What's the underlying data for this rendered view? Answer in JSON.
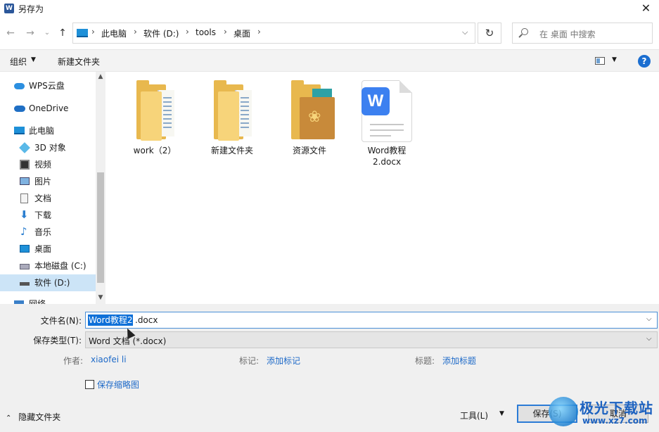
{
  "window": {
    "title": "另存为",
    "app_icon_letter": "W"
  },
  "nav": {
    "back_glyph": "←",
    "forward_glyph": "→",
    "recent_glyph": "⌄",
    "up_glyph": "↑",
    "breadcrumbs": [
      "此电脑",
      "软件 (D:)",
      "tools",
      "桌面"
    ],
    "separator": "›",
    "refresh_glyph": "↻",
    "search_placeholder": "在 桌面 中搜索"
  },
  "toolbar": {
    "organize_label": "组织",
    "new_folder_label": "新建文件夹"
  },
  "sidebar": {
    "items": [
      {
        "label": "WPS云盘",
        "icon": "cloud-icon"
      },
      {
        "label": "OneDrive",
        "icon": "onedrive-icon"
      },
      {
        "label": "此电脑",
        "icon": "computer-icon"
      },
      {
        "label": "3D 对象",
        "icon": "cube-icon"
      },
      {
        "label": "视频",
        "icon": "video-icon"
      },
      {
        "label": "图片",
        "icon": "picture-icon"
      },
      {
        "label": "文档",
        "icon": "document-icon"
      },
      {
        "label": "下载",
        "icon": "download-icon"
      },
      {
        "label": "音乐",
        "icon": "music-icon"
      },
      {
        "label": "桌面",
        "icon": "desktop-icon"
      },
      {
        "label": "本地磁盘 (C:)",
        "icon": "drive-icon"
      },
      {
        "label": "软件 (D:)",
        "icon": "drive-icon",
        "selected": true
      },
      {
        "label": "网络",
        "icon": "network-icon"
      }
    ]
  },
  "files": [
    {
      "name": "work（2）",
      "type": "folder"
    },
    {
      "name": "新建文件夹",
      "type": "folder"
    },
    {
      "name": "资源文件",
      "type": "folder"
    },
    {
      "name": "Word教程2.docx",
      "name_line1": "Word教程",
      "name_line2": "2.docx",
      "type": "docx"
    }
  ],
  "form": {
    "filename_label": "文件名(N):",
    "filename_selected": "Word教程2",
    "filename_rest": ".docx",
    "filetype_label": "保存类型(T):",
    "filetype_value": "Word 文档 (*.docx)",
    "author_label": "作者:",
    "author_value": "xiaofei li",
    "tags_label": "标记:",
    "tags_value": "添加标记",
    "title_label": "标题:",
    "title_value": "添加标题",
    "thumbnail_label": "保存缩略图"
  },
  "footer": {
    "hide_folders_label": "隐藏文件夹",
    "tools_label": "工具(L)",
    "save_label": "保存(S)",
    "cancel_label": "取消"
  },
  "watermark": {
    "text": "极光下载站",
    "url": "www.xz7.com"
  },
  "colors": {
    "accent": "#0e70d8",
    "link": "#1e6ac8",
    "selection": "#cce4f7"
  }
}
